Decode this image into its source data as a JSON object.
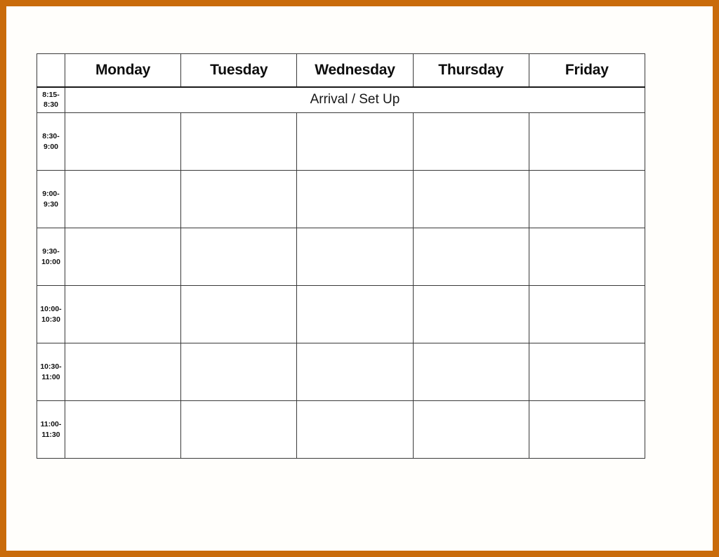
{
  "frame": {
    "border_color": "#c96b0b",
    "page_background": "#ffffff"
  },
  "schedule": {
    "corner_label": "",
    "day_headers": [
      "Monday",
      "Tuesday",
      "Wednesday",
      "Thursday",
      "Friday"
    ],
    "banner": {
      "time_label": "8:15-\n8:30",
      "text": "Arrival / Set Up"
    },
    "rows": [
      {
        "time_label": "8:30-\n9:00",
        "cells": [
          "",
          "",
          "",
          "",
          ""
        ]
      },
      {
        "time_label": "9:00-\n9:30",
        "cells": [
          "",
          "",
          "",
          "",
          ""
        ]
      },
      {
        "time_label": "9:30-\n10:00",
        "cells": [
          "",
          "",
          "",
          "",
          ""
        ]
      },
      {
        "time_label": "10:00-\n10:30",
        "cells": [
          "",
          "",
          "",
          "",
          ""
        ]
      },
      {
        "time_label": "10:30-\n11:00",
        "cells": [
          "",
          "",
          "",
          "",
          ""
        ]
      },
      {
        "time_label": "11:00-\n11:30",
        "cells": [
          "",
          "",
          "",
          "",
          ""
        ]
      }
    ]
  }
}
